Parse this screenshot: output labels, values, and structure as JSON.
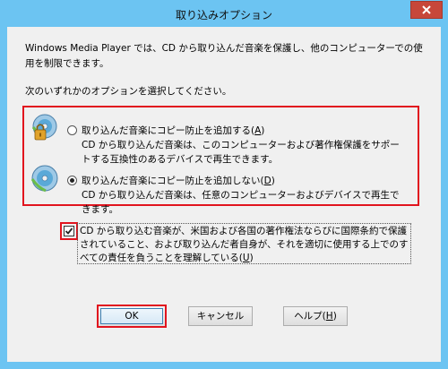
{
  "window": {
    "title": "取り込みオプション"
  },
  "intro": "Windows Media Player では、CD から取り込んだ音楽を保護し、他のコンピューターでの使用を制限できます。",
  "prompt": "次のいずれかのオプションを選択してください。",
  "options": [
    {
      "label_main": "取り込んだ音楽にコピー防止を追加する(",
      "label_key": "A",
      "label_end": ")",
      "description": "CD から取り込んだ音楽は、このコンピューターおよび著作権保護をサポートする互換性のあるデバイスで再生できます。",
      "selected": false,
      "icon": "cd-lock-icon"
    },
    {
      "label_main": "取り込んだ音楽にコピー防止を追加しない(",
      "label_key": "D",
      "label_end": ")",
      "description": "CD から取り込んだ音楽は、任意のコンピューターおよびデバイスで再生できます。",
      "selected": true,
      "icon": "cd-icon"
    }
  ],
  "acknowledgement": {
    "text_main": "CD から取り込む音楽が、米国および各国の著作権法ならびに国際条約で保護されていること、および取り込んだ者自身が、それを適切に使用する上でのすべての責任を負うことを理解している(",
    "text_key": "U",
    "text_end": ")",
    "checked": true
  },
  "buttons": {
    "ok": "OK",
    "cancel": "キャンセル",
    "help_main": "ヘルプ(",
    "help_key": "H",
    "help_end": ")"
  },
  "colors": {
    "titlebar": "#6cc4f2",
    "highlight": "#e1141e",
    "close": "#c7473a"
  }
}
